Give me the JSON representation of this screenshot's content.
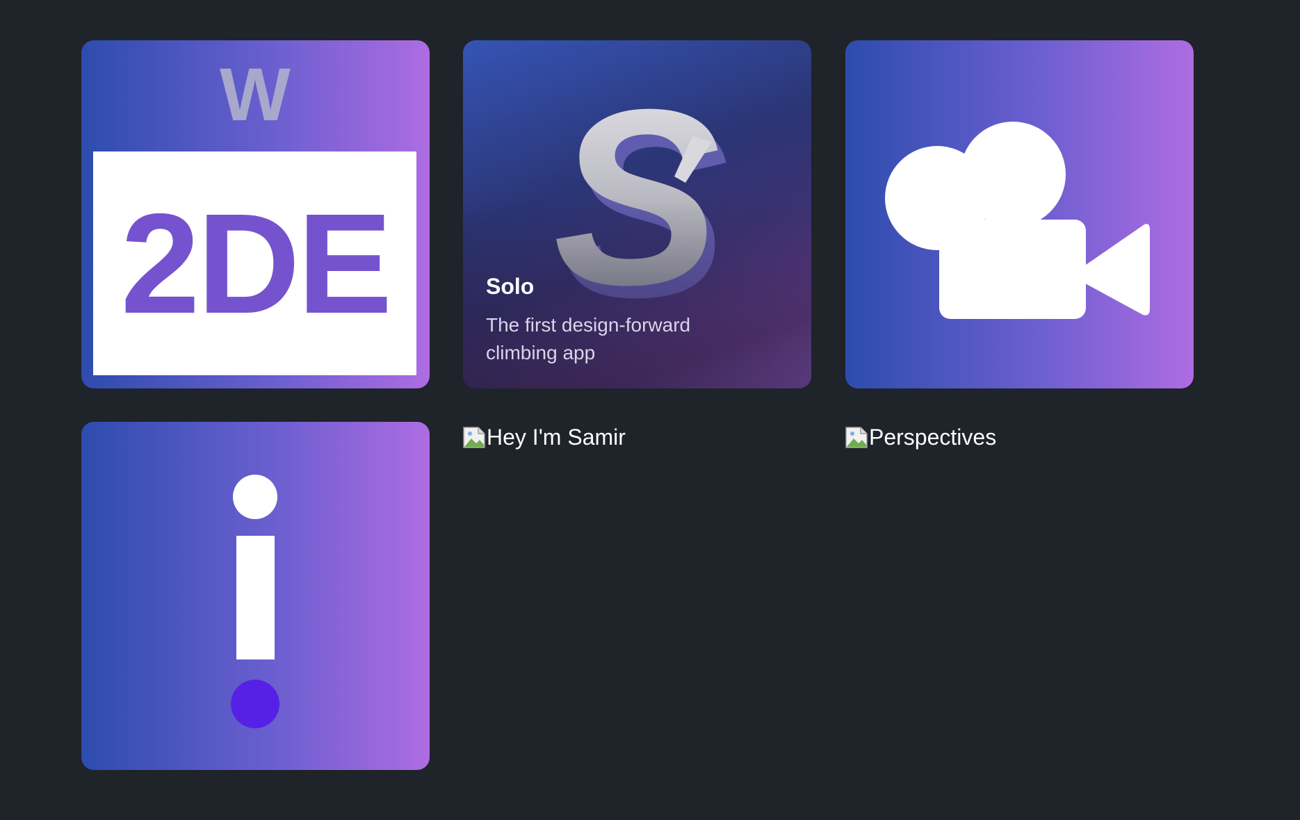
{
  "cards": {
    "twode": {
      "logo_top_letter": "W",
      "logo_text": "2DE"
    },
    "solo": {
      "logo_letter": "S",
      "title": "Solo",
      "description": "The first design-forward climbing app"
    }
  },
  "broken_images": [
    {
      "alt": "Hey I'm Samir"
    },
    {
      "alt": "Perspectives"
    }
  ],
  "colors": {
    "background": "#1f232a",
    "gradient_start": "#2d4cae",
    "gradient_end": "#ae6ce2",
    "info_dot": "#5720e6"
  }
}
